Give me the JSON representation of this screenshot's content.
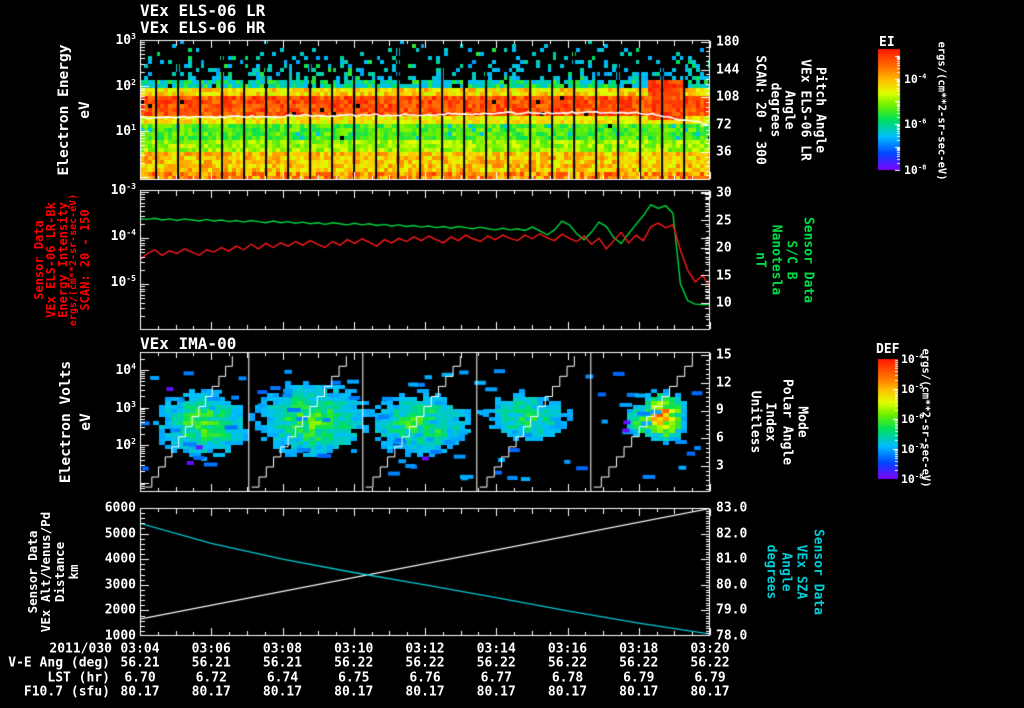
{
  "app": {
    "background": "#000000"
  },
  "titles": {
    "els_lr": "VEx ELS-06 LR",
    "els_hr": "VEx ELS-06 HR",
    "ima": "VEx IMA-00"
  },
  "accents": {
    "red": "#ff0000",
    "green": "#00dd44",
    "cyan": "#00ccd6",
    "white": "#ffffff",
    "speckle_blue": "#28a8f0"
  },
  "colorbar_els": {
    "label": "EI",
    "units": "ergs/(cm**2-sr-sec-eV)",
    "tick_exponents": [
      -4,
      -6,
      -8
    ]
  },
  "colorbar_ima": {
    "label": "DEF",
    "units": "ergs/(cm**2-sr-sec-eV)",
    "tick_exponents": [
      -4,
      -5,
      -6,
      -7,
      -8
    ]
  },
  "panel_els": {
    "left_label_lines": [
      "Electron Energy",
      "eV"
    ],
    "left_tick_exponents": [
      3,
      2,
      1
    ],
    "right_ticks": [
      180,
      144,
      108,
      72,
      36
    ],
    "right_label_lines": [
      "Pitch Angle",
      "VEx ELS-06 LR",
      "Angle",
      "degrees",
      "SCAN: 20 - 300"
    ]
  },
  "panel_bk": {
    "left_label_lines": [
      "Sensor Data",
      "VEx ELS-06 LR-Bk",
      "Energy Intensity",
      "ergs/(cm**2-sr-sec-eV)",
      "SCAN: 20 - 150"
    ],
    "left_tick_exponents": [
      -3,
      -4,
      -5
    ],
    "right_ticks": [
      30,
      25,
      20,
      15,
      10
    ],
    "right_label_lines": [
      "Sensor Data",
      "S/C B",
      "Nanotesla",
      "nT"
    ]
  },
  "panel_ima": {
    "left_label_lines": [
      "Electron Volts",
      "eV"
    ],
    "left_tick_exponents": [
      4,
      3,
      2
    ],
    "right_ticks": [
      15,
      12,
      9,
      6,
      3
    ],
    "right_label_lines": [
      "Mode",
      "Polar Angle",
      "Index",
      "Unitless"
    ]
  },
  "panel_eph": {
    "left_label_lines": [
      "Sensor Data",
      "VEx Alt/Venus/Pd",
      "Distance",
      "km"
    ],
    "left_ticks": [
      6000,
      5000,
      4000,
      3000,
      2000,
      1000
    ],
    "right_ticks": [
      "83.0",
      "82.0",
      "81.0",
      "80.0",
      "79.0",
      "78.0"
    ],
    "right_label_lines": [
      "Sensor Data",
      "VEx SZA",
      "Angle",
      "degrees"
    ]
  },
  "time_axis": {
    "date": "2011/030",
    "times": [
      "03:04",
      "03:06",
      "03:08",
      "03:10",
      "03:12",
      "03:14",
      "03:16",
      "03:18",
      "03:20"
    ]
  },
  "table": {
    "rows": [
      {
        "label": "V-E Ang (deg)",
        "values": [
          "56.21",
          "56.21",
          "56.21",
          "56.22",
          "56.22",
          "56.22",
          "56.22",
          "56.22",
          "56.22"
        ]
      },
      {
        "label": "LST (hr)",
        "values": [
          "6.70",
          "6.72",
          "6.74",
          "6.75",
          "6.76",
          "6.77",
          "6.78",
          "6.79",
          "6.79"
        ]
      },
      {
        "label": "F10.7 (sfu)",
        "values": [
          "80.17",
          "80.17",
          "80.17",
          "80.17",
          "80.17",
          "80.17",
          "80.17",
          "80.17",
          "80.17"
        ]
      }
    ]
  },
  "chart_data": [
    {
      "panel": "els_spectrogram",
      "type": "heatmap",
      "title": "VEx ELS-06 LR / VEx ELS-06 HR",
      "x_range": [
        "03:04",
        "03:20"
      ],
      "ylabel": "Electron Energy (eV)",
      "yscale": "log",
      "ytick_exponents": [
        3,
        2,
        1
      ],
      "right_axis": {
        "label": "Pitch Angle VEx ELS-06 LR Angle degrees SCAN: 20 - 300",
        "ticks": [
          36,
          72,
          108,
          144,
          180
        ],
        "range": [
          0,
          183
        ]
      },
      "colorbar": {
        "label": "EI",
        "units": "ergs/(cm**2-sr-sec-eV)",
        "tick_exponents": [
          -4,
          -6,
          -8
        ]
      },
      "features": {
        "bands": [
          {
            "energy_eV": [
              100,
              1000
            ],
            "flux": "sparse cyan-blue speckles on black"
          },
          {
            "energy_eV": [
              25,
              90
            ],
            "flux": "intense red-orange band"
          },
          {
            "energy_eV": [
              3,
              25
            ],
            "flux": "green-yellow flux"
          },
          {
            "energy_eV": [
              1,
              3
            ],
            "flux": "orange-red flux"
          }
        ],
        "white_trace_frac": [
          [
            0,
            0.555
          ],
          [
            0.15,
            0.55
          ],
          [
            0.3,
            0.542
          ],
          [
            0.45,
            0.535
          ],
          [
            0.6,
            0.525
          ],
          [
            0.75,
            0.518
          ],
          [
            0.85,
            0.515
          ],
          [
            0.9,
            0.53
          ],
          [
            0.95,
            0.575
          ],
          [
            1,
            0.6
          ]
        ],
        "gap_columns": {
          "count": 25,
          "first_frac": 0.0265,
          "step_frac": 0.0386
        },
        "hot_patch": {
          "x_frac": [
            0.885,
            0.952
          ],
          "y_frac": [
            0.26,
            0.56
          ]
        }
      }
    },
    {
      "panel": "bk_line",
      "type": "line",
      "series": [
        {
          "name": "VEx ELS-06 LR-Bk Energy Intensity SCAN: 20 - 150",
          "color": "#ff1a1a",
          "axis": "left",
          "units": "ergs/(cm**2-sr-sec-eV)",
          "log10_values": [
            -4.52,
            -4.38,
            -4.3,
            -4.42,
            -4.32,
            -4.38,
            -4.28,
            -4.35,
            -4.42,
            -4.3,
            -4.35,
            -4.25,
            -4.33,
            -4.22,
            -4.3,
            -4.18,
            -4.28,
            -4.16,
            -4.25,
            -4.15,
            -4.22,
            -4.12,
            -4.2,
            -4.1,
            -4.18,
            -4.25,
            -4.12,
            -4.2,
            -4.08,
            -4.16,
            -4.06,
            -4.14,
            -4.22,
            -4.08,
            -4.15,
            -4.05,
            -4.12,
            -4.02,
            -4.1,
            -4.0,
            -4.08,
            -4.15,
            -4.02,
            -4.1,
            -3.98,
            -4.06,
            -4.12,
            -4.0,
            -4.08,
            -3.98,
            -4.05,
            -4.1,
            -3.98,
            -4.06,
            -3.95,
            -4.04,
            -4.1,
            -3.96,
            -4.05,
            -4.12,
            -4.0,
            -4.18,
            -4.05,
            -4.28,
            -4.1,
            -3.92,
            -4.15,
            -3.98,
            -4.1,
            -3.8,
            -3.72,
            -3.82,
            -3.76,
            -4.3,
            -4.75,
            -5.0,
            -4.85,
            -5.12
          ]
        },
        {
          "name": "S/C B",
          "color": "#00d73c",
          "axis": "right",
          "units": "nT",
          "values": [
            25.3,
            25.2,
            25.4,
            25.1,
            25.3,
            25.0,
            25.3,
            25.1,
            24.9,
            25.2,
            24.9,
            25.1,
            24.8,
            25.0,
            24.7,
            25.0,
            24.8,
            24.6,
            24.9,
            24.6,
            24.8,
            24.5,
            24.7,
            24.4,
            24.6,
            24.3,
            24.6,
            24.4,
            24.2,
            24.5,
            24.2,
            24.4,
            24.1,
            24.3,
            24.0,
            24.2,
            23.9,
            24.1,
            23.8,
            24.0,
            23.7,
            23.9,
            23.6,
            23.9,
            23.7,
            23.5,
            23.8,
            23.5,
            23.3,
            23.6,
            23.3,
            23.5,
            23.2,
            23.8,
            23.1,
            22.4,
            23.3,
            24.9,
            24.2,
            22.6,
            21.5,
            22.9,
            24.7,
            23.9,
            21.9,
            20.8,
            22.6,
            24.3,
            25.9,
            27.9,
            27.2,
            27.7,
            26.3,
            13.5,
            10.4,
            9.8,
            9.7,
            9.7
          ]
        }
      ],
      "left_axis": {
        "scale": "log",
        "tick_exponents": [
          -3,
          -4,
          -5
        ]
      },
      "right_axis": {
        "ticks": [
          10,
          15,
          20,
          25,
          30
        ],
        "range": [
          5,
          30.5
        ]
      }
    },
    {
      "panel": "ima_spectrogram",
      "type": "heatmap",
      "title": "VEx IMA-00",
      "ylabel": "Electron Volts (eV)",
      "yscale": "log",
      "ytick_exponents": [
        4,
        3,
        2
      ],
      "right_axis": {
        "labels": [
          "Mode",
          "Polar Angle",
          "Index",
          "Unitless"
        ],
        "ticks": [
          3,
          6,
          9,
          12,
          15
        ]
      },
      "colorbar": {
        "label": "DEF",
        "units": "ergs/(cm**2-sr-sec-eV)",
        "tick_exponents": [
          -4,
          -5,
          -6,
          -7,
          -8
        ]
      },
      "features": {
        "segment_boundaries_frac": [
          0.19,
          0.39,
          0.59,
          0.79
        ],
        "staircase": "white scan staircase rising across each segment",
        "blobs": [
          {
            "cx": 0.105,
            "cy": 0.5,
            "rx": 0.08,
            "ry": 0.24,
            "peak": 0.5
          },
          {
            "cx": 0.298,
            "cy": 0.47,
            "rx": 0.095,
            "ry": 0.26,
            "peak": 0.52
          },
          {
            "cx": 0.488,
            "cy": 0.5,
            "rx": 0.09,
            "ry": 0.22,
            "peak": 0.48
          },
          {
            "cx": 0.672,
            "cy": 0.45,
            "rx": 0.08,
            "ry": 0.18,
            "peak": 0.42
          },
          {
            "cx": 0.872,
            "cy": 0.48,
            "rx": 0.025,
            "ry": 0.12,
            "peak": 0.5
          },
          {
            "cx": 0.912,
            "cy": 0.45,
            "rx": 0.035,
            "ry": 0.15,
            "peak": 0.95
          }
        ]
      }
    },
    {
      "panel": "ephemeris",
      "type": "line",
      "series": [
        {
          "name": "VEx Alt/Venus/Pd Distance",
          "color": "#ffffff",
          "axis": "left",
          "units": "km",
          "points": [
            [
              0,
              1660
            ],
            [
              1,
              5980
            ]
          ]
        },
        {
          "name": "VEx SZA",
          "color": "#00c8d2",
          "axis": "right",
          "units": "degrees",
          "points": [
            [
              0,
              82.4
            ],
            [
              0.125,
              81.62
            ],
            [
              0.25,
              81.0
            ],
            [
              0.375,
              80.48
            ],
            [
              0.5,
              80.0
            ],
            [
              0.625,
              79.5
            ],
            [
              0.75,
              78.98
            ],
            [
              0.875,
              78.5
            ],
            [
              1,
              78.08
            ]
          ]
        }
      ],
      "left_axis": {
        "ticks": [
          1000,
          2000,
          3000,
          4000,
          5000,
          6000
        ]
      },
      "right_axis": {
        "ticks": [
          78,
          79,
          80,
          81,
          82,
          83
        ]
      }
    }
  ]
}
